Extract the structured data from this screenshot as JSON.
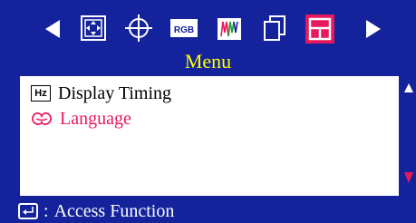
{
  "menu": {
    "title": "Menu",
    "icons": [
      "arrow-left-icon",
      "position-icon",
      "shape-icon",
      "rgb-icon",
      "color-bars-icon",
      "copy-icon",
      "menu-icon",
      "arrow-right-icon"
    ],
    "rgb_label": "RGB",
    "active_icon": "menu-icon"
  },
  "items": [
    {
      "icon": "hz-icon",
      "badge": "Hz",
      "label": "Display Timing"
    },
    {
      "icon": "language-icon",
      "label": "Language"
    }
  ],
  "footer": {
    "separator": ":",
    "label": "Access Function"
  },
  "colors": {
    "background": "#14239c",
    "title": "#ffff00",
    "highlight": "#e8185c",
    "panel": "#ffffff",
    "active_icon": "#e8185c"
  }
}
